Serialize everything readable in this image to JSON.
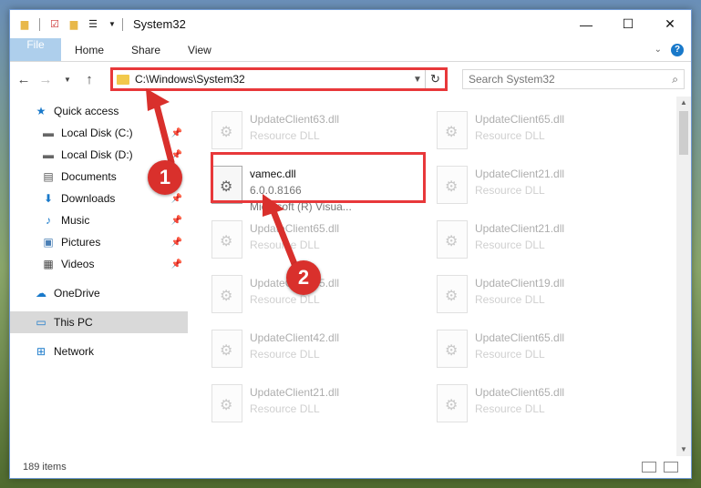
{
  "window": {
    "title": "System32"
  },
  "ribbon": {
    "tabs": [
      "File",
      "Home",
      "Share",
      "View"
    ],
    "help": "?"
  },
  "address": {
    "path": "C:\\Windows\\System32"
  },
  "search": {
    "placeholder": "Search System32"
  },
  "sidebar": {
    "items": [
      {
        "label": "Quick access",
        "icon": "star-icon"
      },
      {
        "label": "Local Disk (C:)",
        "icon": "drive-icon"
      },
      {
        "label": "Local Disk (D:)",
        "icon": "drive-icon"
      },
      {
        "label": "Documents",
        "icon": "documents-icon"
      },
      {
        "label": "Downloads",
        "icon": "downloads-icon"
      },
      {
        "label": "Music",
        "icon": "music-icon"
      },
      {
        "label": "Pictures",
        "icon": "pictures-icon"
      },
      {
        "label": "Videos",
        "icon": "videos-icon"
      },
      {
        "label": "OneDrive",
        "icon": "cloud-icon"
      },
      {
        "label": "This PC",
        "icon": "computer-icon"
      },
      {
        "label": "Network",
        "icon": "network-icon"
      }
    ]
  },
  "files": [
    {
      "name": "UpdateClient63.dll",
      "type": "Resource DLL"
    },
    {
      "name": "UpdateClient65.dll",
      "type": "Resource DLL"
    },
    {
      "name": "vamec.dll",
      "version": "6.0.0.8166",
      "company": "Microsoft (R) Visua..."
    },
    {
      "name": "UpdateClient21.dll",
      "type": "Resource DLL"
    },
    {
      "name": "UpdateClient65.dll",
      "type": "Resource DLL"
    },
    {
      "name": "UpdateClient21.dll",
      "type": "Resource DLL"
    },
    {
      "name": "UpdateClient65.dll",
      "type": "Resource DLL"
    },
    {
      "name": "UpdateClient19.dll",
      "type": "Resource DLL"
    },
    {
      "name": "UpdateClient42.dll",
      "type": "Resource DLL"
    },
    {
      "name": "UpdateClient65.dll",
      "type": "Resource DLL"
    },
    {
      "name": "UpdateClient21.dll",
      "type": "Resource DLL"
    },
    {
      "name": "UpdateClient65.dll",
      "type": "Resource DLL"
    }
  ],
  "status": {
    "count": "189 items"
  },
  "annotations": {
    "marker1": "1",
    "marker2": "2"
  },
  "colors": {
    "accent": "#1979ca",
    "highlight": "#e8383a",
    "marker": "#d9302c"
  }
}
